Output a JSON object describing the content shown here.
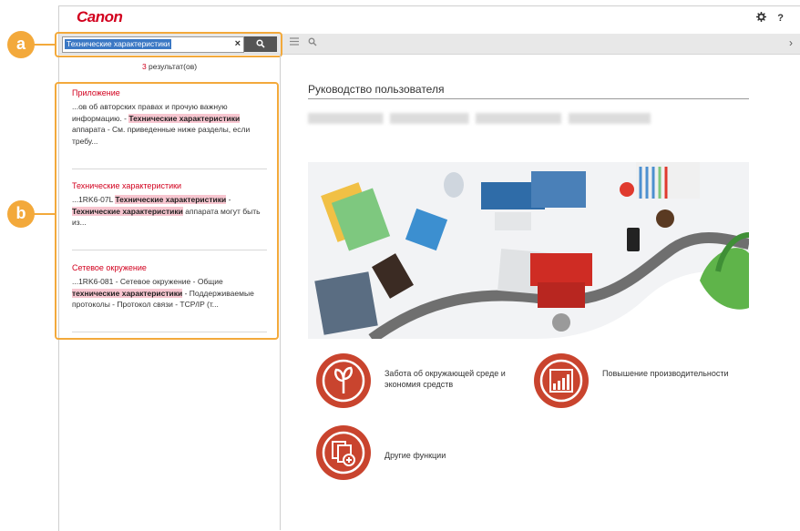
{
  "header": {
    "logo": "Canon",
    "settings_icon": "gear-icon",
    "help_label": "?"
  },
  "search": {
    "value": "Технические характеристики",
    "clear_label": "×",
    "button_icon": "search-icon"
  },
  "toolbar": {
    "list_icon": "list-icon",
    "search_icon": "search-icon",
    "next_label": "›"
  },
  "callouts": {
    "a": "a",
    "b": "b"
  },
  "results": {
    "count": "3",
    "count_suffix": " результат(ов)",
    "items": [
      {
        "title": "Приложение",
        "pre": "...ов об авторских правах и прочую важную информацию. - ",
        "hit1": "Технические характеристики",
        "post": " аппарата - См. приведенные ниже разделы, если требу..."
      },
      {
        "title": "Технические характеристики",
        "pre": "...1RK6-07L ",
        "hit1": "Технические характеристики",
        "mid": " - ",
        "hit2": "Технические характеристики",
        "post": " аппарата могут быть из..."
      },
      {
        "title": "Сетевое окружение",
        "pre": "...1RK6-081 - Сетевое окружение - Общие ",
        "hit1": "технические характеристики",
        "post": " - Поддерживаемые протоколы - Протокол связи - TCP/IP (т..."
      }
    ]
  },
  "main": {
    "title": "Руководство пользователя",
    "menu": [
      {
        "icon": "leaf-icon",
        "label": "Забота об окружающей среде и экономия средств"
      },
      {
        "icon": "chart-icon",
        "label": "Повышение производительности"
      },
      {
        "icon": "documents-icon",
        "label": "Другие функции"
      }
    ]
  },
  "colors": {
    "brand": "#d2001e",
    "callout": "#f3a93b",
    "menu_icon": "#c9442e",
    "highlight": "#f7c6d0"
  }
}
